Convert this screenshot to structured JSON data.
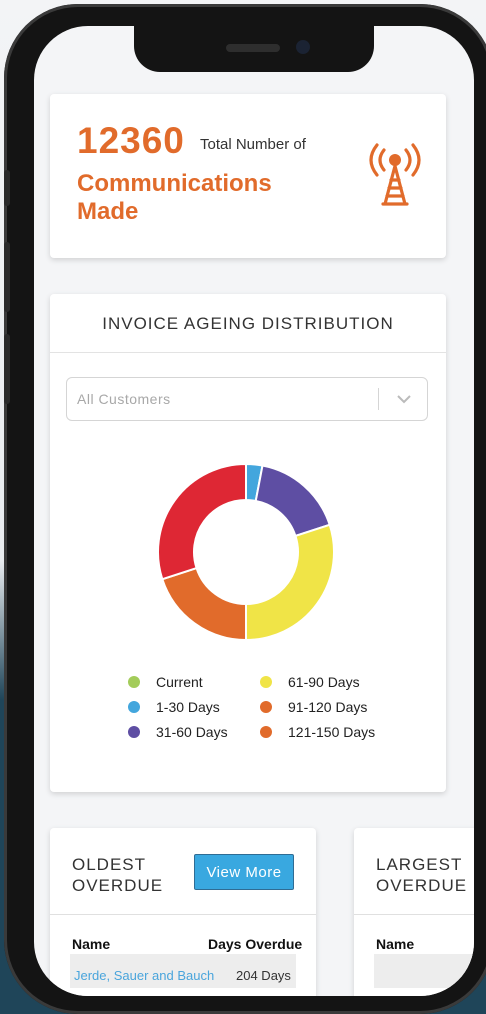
{
  "communications": {
    "count": "12360",
    "label_small": "Total Number of",
    "label_big": "Communications Made"
  },
  "invoice_ageing": {
    "title": "INVOICE AGEING DISTRIBUTION",
    "filter_placeholder": "All Customers",
    "legend": [
      {
        "label": "Current",
        "color": "#a3cc5a"
      },
      {
        "label": "1-30 Days",
        "color": "#43a6dd"
      },
      {
        "label": "31-60 Days",
        "color": "#5e4ea3"
      },
      {
        "label": "61-90 Days",
        "color": "#f0e447"
      },
      {
        "label": "91-120 Days",
        "color": "#e16b2b"
      },
      {
        "label": "121-150 Days",
        "color": "#e16b2b"
      }
    ]
  },
  "chart_data": {
    "type": "pie",
    "categories": [
      "Current",
      "1-30 Days",
      "31-60 Days",
      "61-90 Days",
      "91-120 Days",
      "121-150 Days"
    ],
    "values": [
      0,
      3,
      17,
      30,
      20,
      30
    ],
    "slice_colors": [
      "#a3cc5a",
      "#43a6dd",
      "#5e4ea3",
      "#f0e447",
      "#e16b2b",
      "#de2734"
    ],
    "donut": true
  },
  "oldest_overdue": {
    "title": "OLDEST OVERDUE",
    "button": "View More",
    "columns": [
      "Name",
      "Days Overdue"
    ],
    "rows": [
      {
        "name": "Jerde, Sauer and Bauch",
        "days": "204 Days"
      }
    ]
  },
  "largest_overdue": {
    "title": "LARGEST OVERDUE",
    "columns": [
      "Name"
    ]
  },
  "colors": {
    "accent": "#e16b2b",
    "button": "#39a8e0"
  }
}
